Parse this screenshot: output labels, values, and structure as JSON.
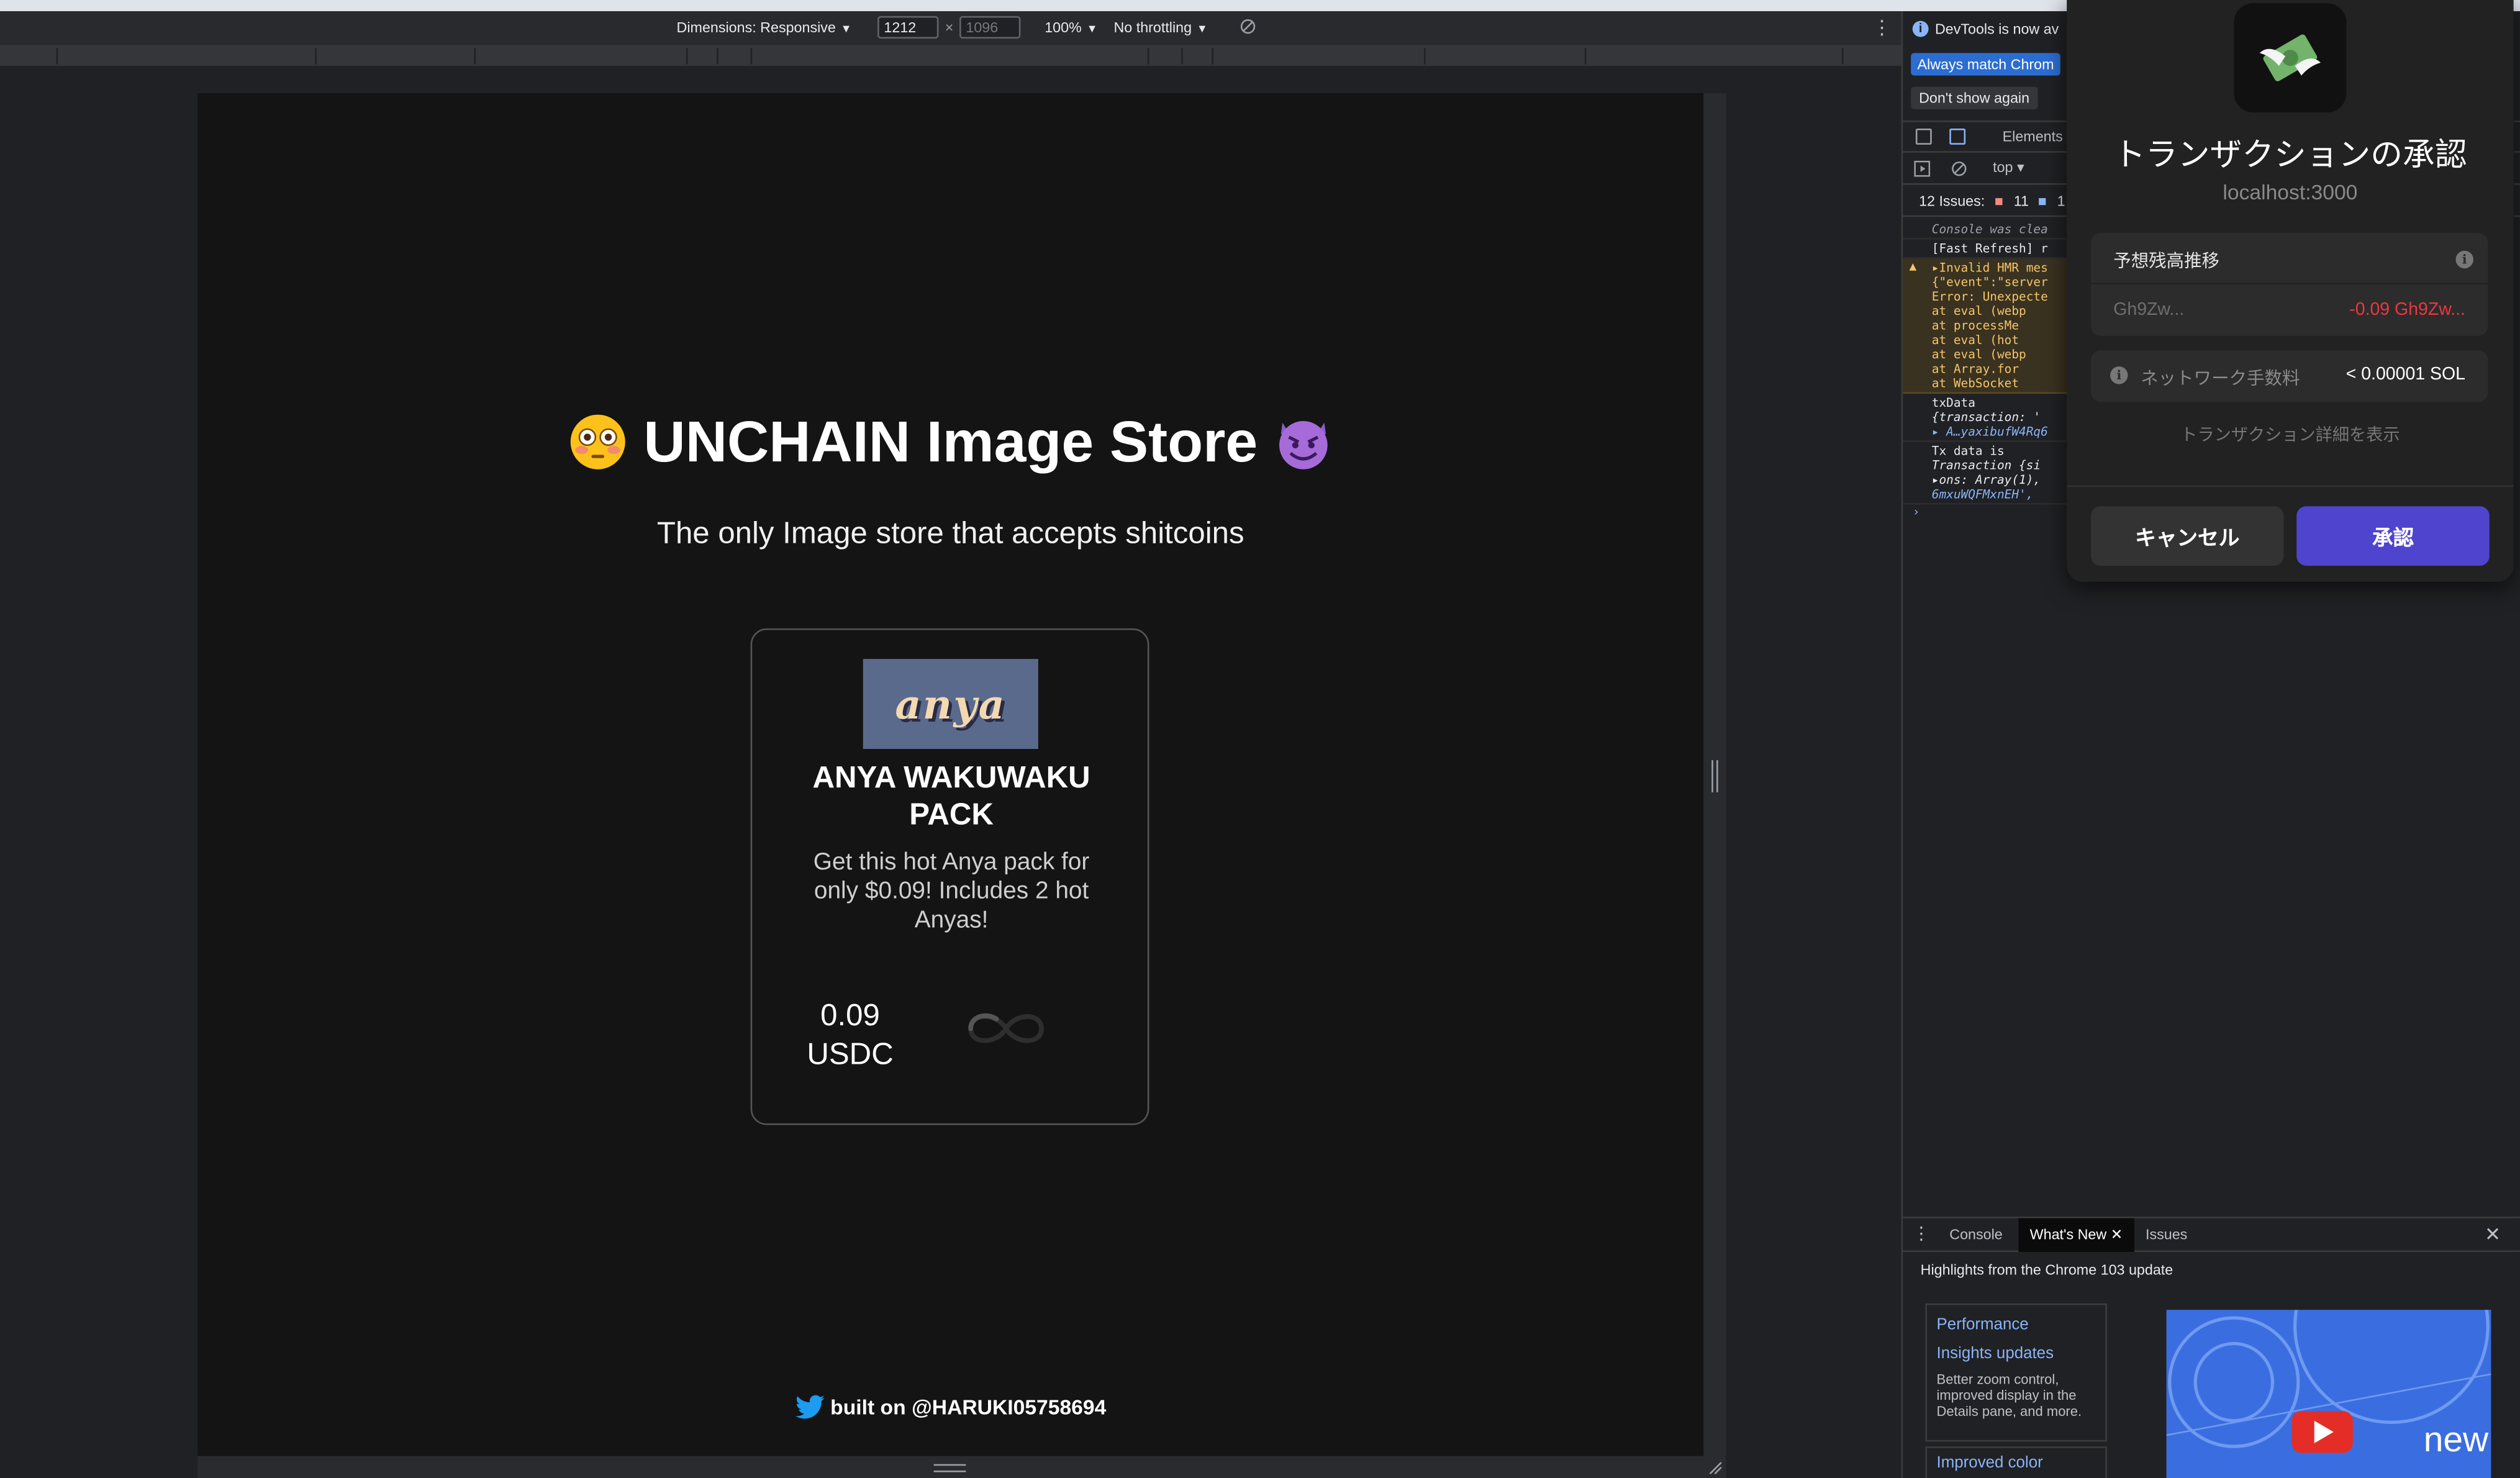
{
  "device_toolbar": {
    "dimensions_label": "Dimensions: Responsive",
    "width_value": "1212",
    "height_placeholder": "1096",
    "times": "×",
    "zoom": "100%",
    "throttle": "No throttling",
    "more_icon": "kebab-menu-icon",
    "rotate_icon": "rotate-icon"
  },
  "app": {
    "title": "UNCHAIN Image Store",
    "title_left_emoji": "flushed-face-emoji",
    "title_right_emoji": "smiling-devil-emoji",
    "subtitle": "The only Image store that accepts shitcoins",
    "product": {
      "image_text": "anya",
      "name": "ANYA WAKUWAKU PACK",
      "description": "Get this hot Anya pack for only $0.09! Includes 2 hot Anyas!",
      "price": "0.09",
      "currency": "USDC",
      "loading": true
    },
    "footer": "built on @HARUKI05758694",
    "footer_icon": "twitter-icon"
  },
  "devtools": {
    "info_text": "DevTools is now av",
    "always_match": "Always match Chrom",
    "dont_show": "Don't show again",
    "elements_tab": "Elements",
    "context": "top",
    "issues_label": "12 Issues:",
    "issues_errors": "11",
    "issues_info": "1",
    "console_lines": [
      {
        "text": "Console was clea",
        "kind": "dim"
      },
      {
        "text": "[Fast Refresh] r",
        "kind": "normal"
      },
      {
        "text": "▸Invalid HMR mes",
        "kind": "warn"
      },
      {
        "text": "{\"event\":\"server",
        "kind": "warn"
      },
      {
        "text": "Error: Unexpecte",
        "kind": "warn"
      },
      {
        "text": "   at eval (webp",
        "kind": "warn"
      },
      {
        "text": "   at processMe",
        "kind": "warn"
      },
      {
        "text": "   at eval (hot",
        "kind": "warn"
      },
      {
        "text": "   at eval (webp",
        "kind": "warn"
      },
      {
        "text": "   at Array.for",
        "kind": "warn"
      },
      {
        "text": "   at WebSocket",
        "kind": "warn"
      },
      {
        "text": "txData",
        "kind": "normal"
      },
      {
        "text": "  {transaction: '",
        "kind": "ital"
      },
      {
        "text": "▸ A…yaxibufW4Rq6",
        "kind": "ital"
      },
      {
        "text": "Tx data is",
        "kind": "normal"
      },
      {
        "text": "  Transaction {si",
        "kind": "ital"
      },
      {
        "text": "▸ons: Array(1),",
        "kind": "ital"
      },
      {
        "text": "  6mxuWQFMxnEH',",
        "kind": "ital"
      }
    ],
    "drawer": {
      "tabs": [
        "Console",
        "What's New",
        "Issues"
      ],
      "active_tab": "What's New",
      "highlights": "Highlights from the Chrome 103 update",
      "card1_title_a": "Performance",
      "card1_title_b": "Insights updates",
      "card1_desc": "Better zoom control, improved display in the Details pane, and more.",
      "card2_title": "Improved color",
      "video_text": "new"
    }
  },
  "wallet": {
    "icon": "money-with-wings-icon",
    "title": "トランザクションの承認",
    "host": "localhost:3000",
    "balance_change_label": "予想残高推移",
    "address": "Gh9Zw...",
    "delta": "-0.09 Gh9Zw...",
    "fee_label": "ネットワーク手数料",
    "fee_value": "< 0.00001 SOL",
    "details_link": "トランザクション詳細を表示",
    "cancel": "キャンセル",
    "approve": "承認",
    "colors": {
      "approve": "#4e44ce",
      "negative": "#eb3742"
    }
  }
}
